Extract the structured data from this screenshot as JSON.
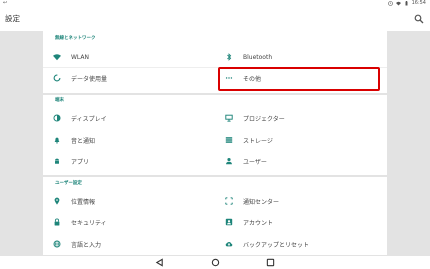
{
  "statusbar": {
    "left_glyph": "↩︎",
    "time": "16:54"
  },
  "appbar": {
    "title": "設定"
  },
  "sections": {
    "wireless": {
      "header": "無線とネットワーク",
      "items": {
        "wlan": "WLAN",
        "bluetooth": "Bluetooth",
        "data_usage": "データ使用量",
        "more": "その他"
      }
    },
    "device": {
      "header": "端末",
      "items": {
        "display": "ディスプレイ",
        "projector": "プロジェクター",
        "sound": "音と通知",
        "storage": "ストレージ",
        "apps": "アプリ",
        "users": "ユーザー"
      }
    },
    "personal": {
      "header": "ユーザー設定",
      "items": {
        "location": "位置情報",
        "notification_center": "通知センター",
        "security": "セキュリティ",
        "accounts": "アカウント",
        "language": "言語と入力",
        "backup": "バックアップとリセット"
      }
    }
  },
  "colors": {
    "accent": "#1e857a",
    "highlight": "#d90000"
  }
}
